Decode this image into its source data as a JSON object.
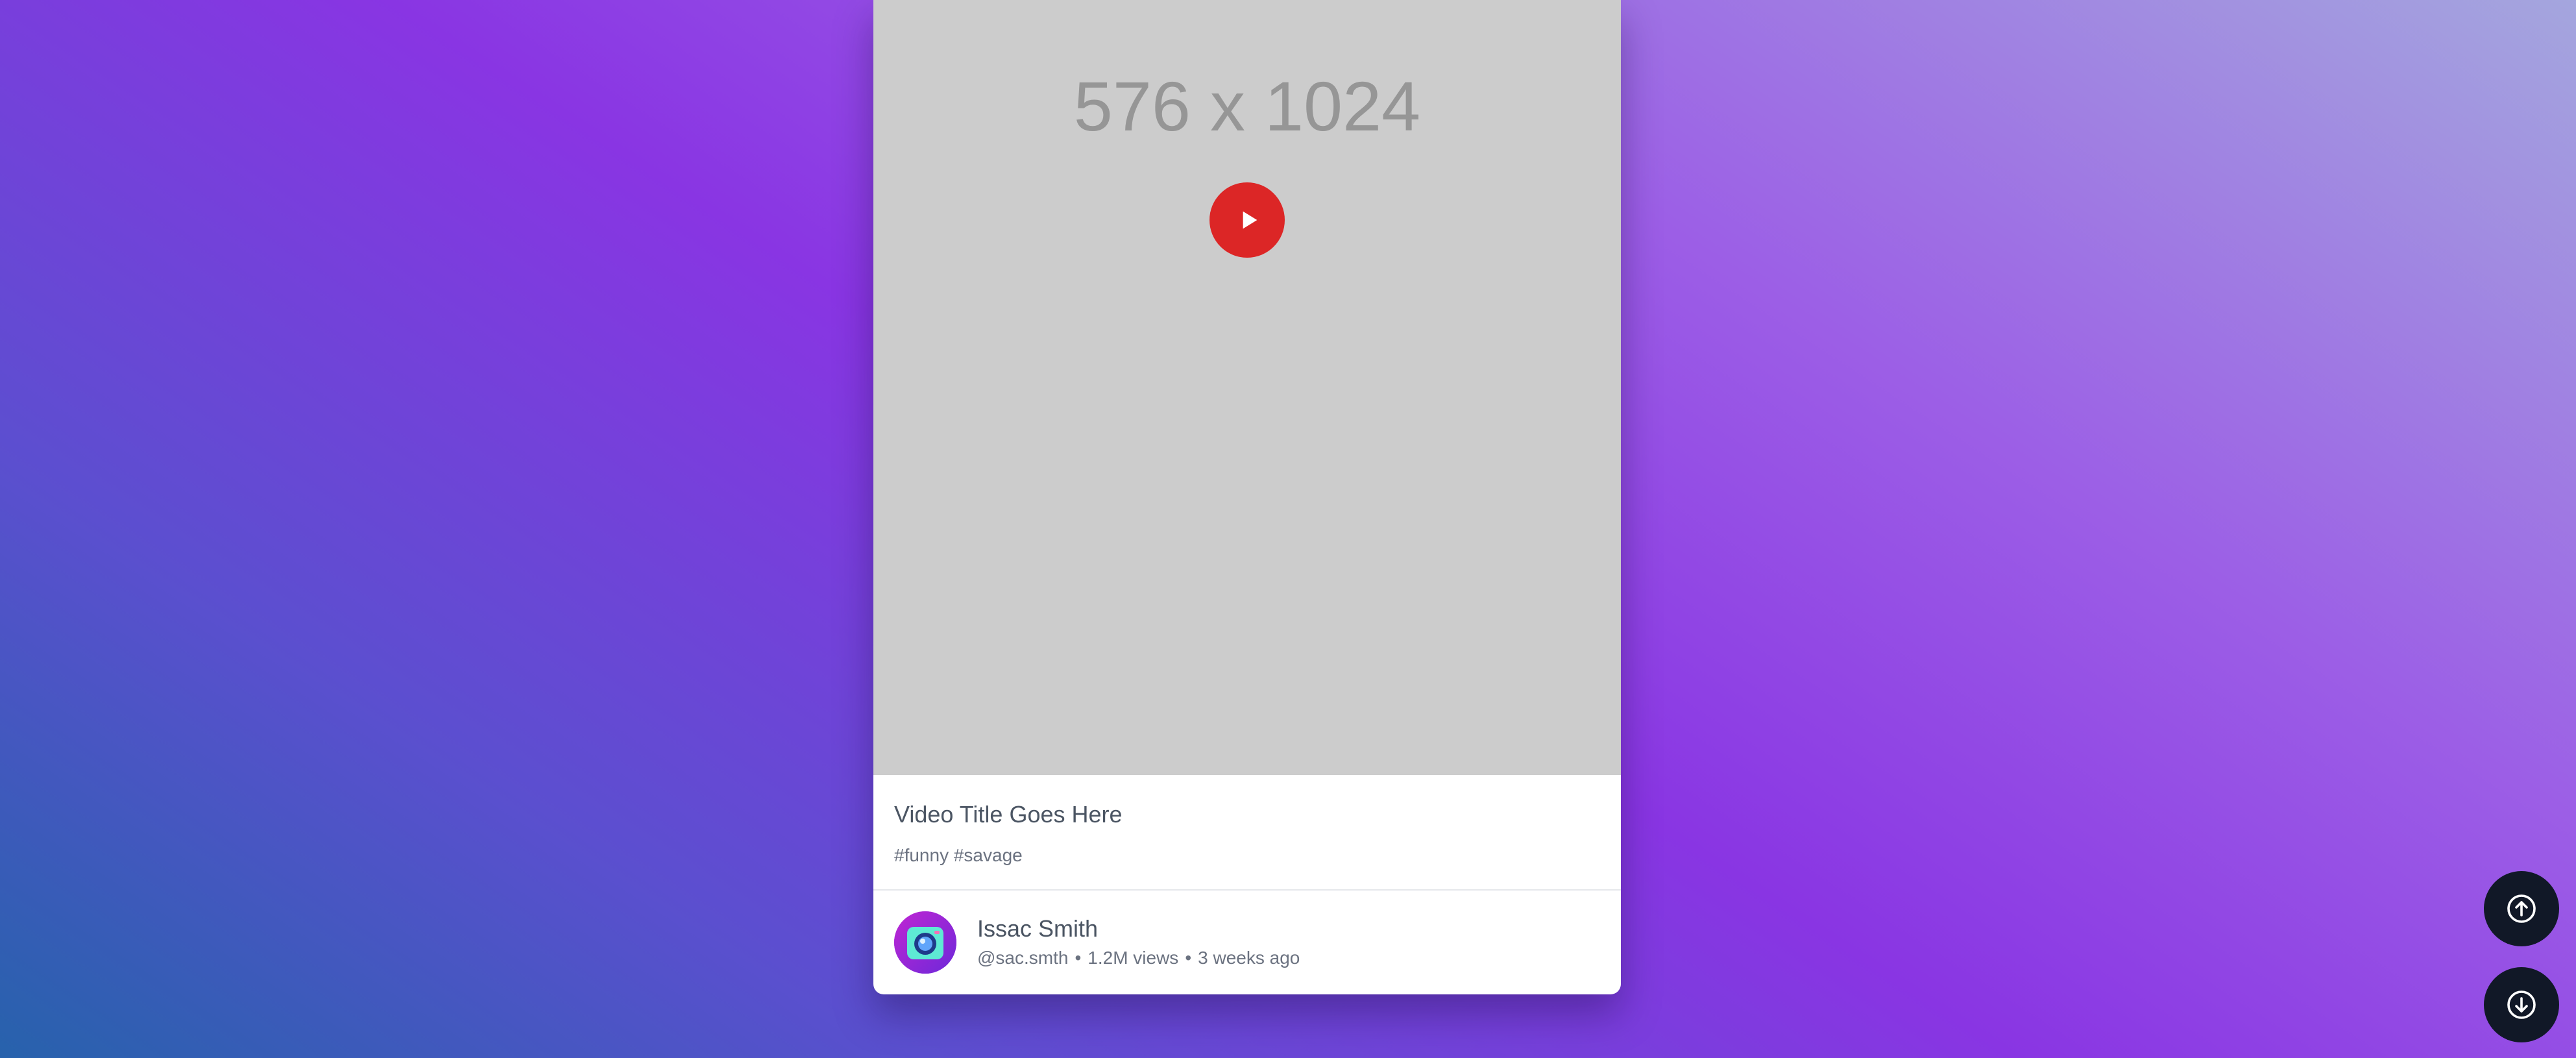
{
  "video": {
    "thumbnail_label": "576 x 1024",
    "title": "Video Title Goes Here",
    "tags": "#funny #savage"
  },
  "author": {
    "name": "Issac Smith",
    "handle": "@sac.smth",
    "views": "1.2M views",
    "posted": "3 weeks ago",
    "separator": "•"
  },
  "controls": {
    "play_icon": "play-icon",
    "scroll_up_icon": "arrow-up-circle-icon",
    "scroll_down_icon": "arrow-down-circle-icon"
  },
  "colors": {
    "play_button": "#dc2626",
    "fab_background": "#111827",
    "thumbnail_background": "#cccccc"
  }
}
